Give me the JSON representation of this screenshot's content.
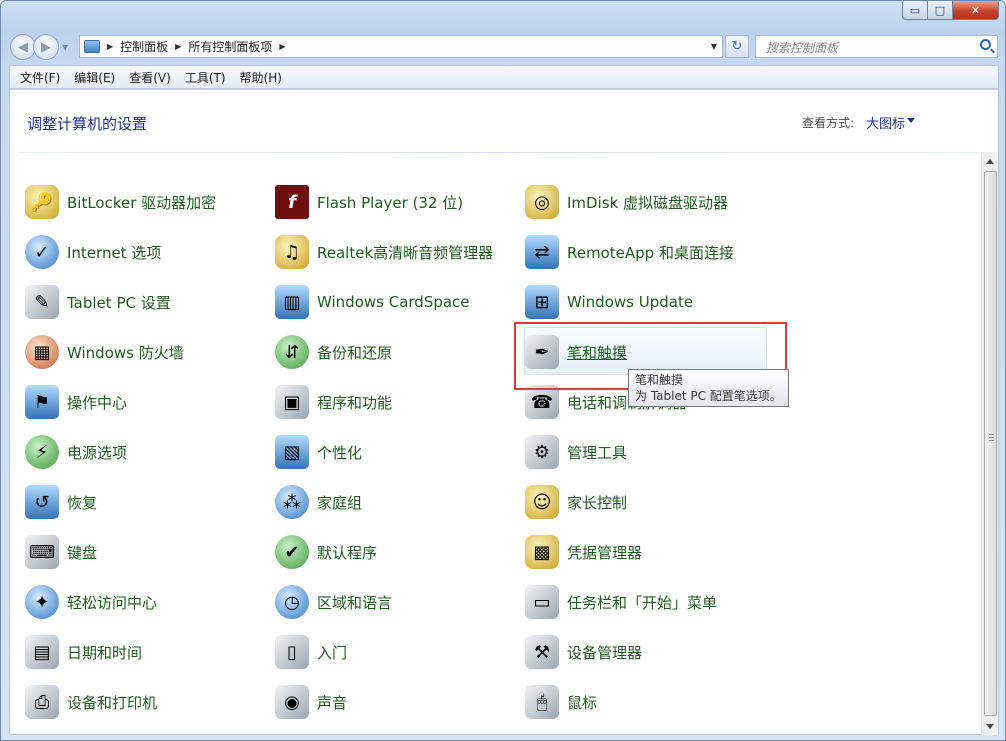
{
  "window": {
    "controls": {
      "minimize": "▭",
      "maximize": "□",
      "close": "✕"
    }
  },
  "address": {
    "crumbs": [
      "控制面板",
      "所有控制面板项"
    ],
    "search_placeholder": "搜索控制面板"
  },
  "menu": [
    "文件(F)",
    "编辑(E)",
    "查看(V)",
    "工具(T)",
    "帮助(H)"
  ],
  "page": {
    "title": "调整计算机的设置",
    "view_by_label": "查看方式:",
    "view_by_value": "大图标"
  },
  "items": {
    "col1": [
      "BitLocker 驱动器加密",
      "Internet 选项",
      "Tablet PC 设置",
      "Windows 防火墙",
      "操作中心",
      "电源选项",
      "恢复",
      "键盘",
      "轻松访问中心",
      "日期和时间",
      "设备和打印机"
    ],
    "col2": [
      "Flash Player (32 位)",
      "Realtek高清晰音频管理器",
      "Windows CardSpace",
      "备份和还原",
      "程序和功能",
      "个性化",
      "家庭组",
      "默认程序",
      "区域和语言",
      "入门",
      "声音"
    ],
    "col3": [
      "ImDisk 虚拟磁盘驱动器",
      "RemoteApp 和桌面连接",
      "Windows Update",
      "笔和触摸",
      "电话和调制解调器",
      "管理工具",
      "家长控制",
      "凭据管理器",
      "任务栏和「开始」菜单",
      "设备管理器",
      "鼠标"
    ]
  },
  "tooltip": {
    "title": "笔和触摸",
    "text": "为 Tablet PC 配置笔选项。"
  },
  "colors": {
    "link_green": "#1e5c1e",
    "title_blue": "#1e3287",
    "highlight_red": "#e03a3a"
  }
}
